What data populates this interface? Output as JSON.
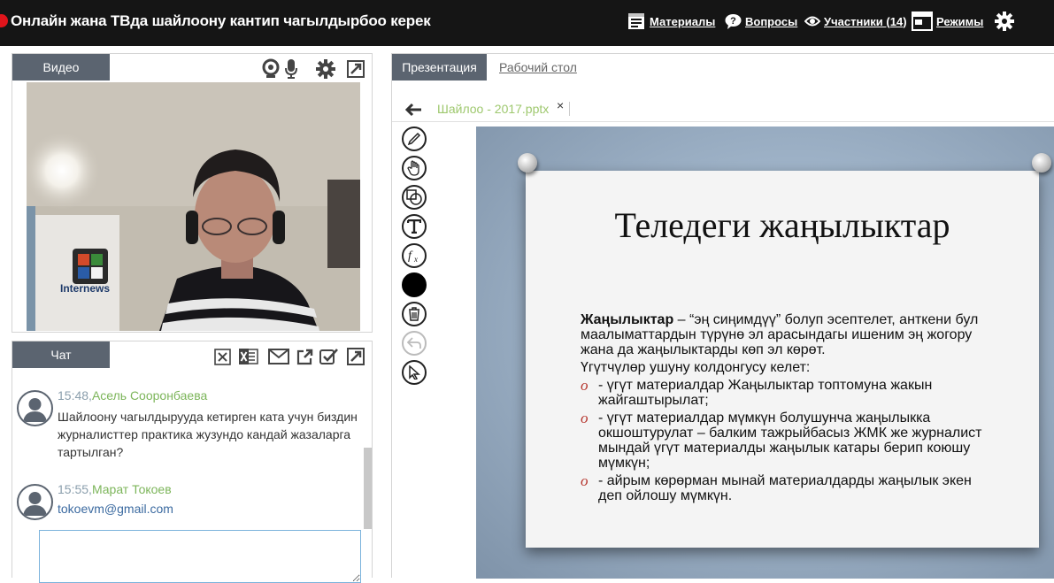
{
  "window": {
    "title": "Онлайн жана ТВда шайлоону кантип чагылдырбоо керек"
  },
  "topnav": {
    "materials": "Материалы",
    "questions": "Вопросы",
    "participants": "Участники (14)",
    "modes": "Режимы"
  },
  "video": {
    "tab_label": "Видео",
    "overlay_logo": "Internews"
  },
  "chat": {
    "tab_label": "Чат",
    "messages": [
      {
        "time": "15:48,",
        "author": "Асель Сооронбаева",
        "text": "Шайлоону чагылдырууда кетирген ката учун биздин журналисттер практика жузундо кандай жазаларга тартылган?"
      },
      {
        "time": "15:55,",
        "author": "Марат Токоев",
        "text": "tokoevm@gmail.com"
      }
    ]
  },
  "presentation": {
    "tab_presentation": "Презентация",
    "tab_desktop": "Рабочий стол",
    "file_name": "Шайлоо - 2017.pptx",
    "file_close": "×",
    "slide": {
      "title": "Теледеги жаңылыктар",
      "lead_bold": "Жаңылыктар",
      "lead_rest": " – “эң сиңимдүү” болуп эсептелет, анткени бул маалыматтардын түрүнө эл арасындагы ишеним эң жогору жана да жаңылыктарды көп эл көрөт.",
      "sub": "Үгүтчүлөр ушуну колдонгусу келет:",
      "bullet_mark": "o",
      "bullets": [
        "- үгүт материалдар Жаңылыктар топтомуна жакын жайгаштырылат;",
        "- үгүт материалдар мүмкүн болушунча жаңылыкка окшоштурулат – балким тажрыйбасыз ЖМК же журналист мындай үгүт материалды жаңылык катары берип коюшу мүмкүн;",
        "- айрым көрөрман мынай материалдарды жаңылык экен деп ойлошу мүмкүн."
      ]
    }
  },
  "colors": {
    "topbar": "#151515",
    "tab": "#5b6470",
    "author": "#7cb55a",
    "link": "#3b6aa0",
    "file_tab": "#9ec86e",
    "bullet": "#b5342c"
  }
}
